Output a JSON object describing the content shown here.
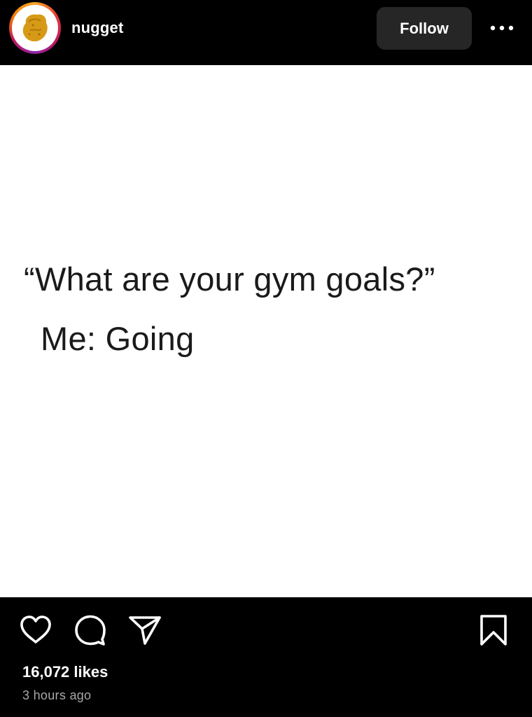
{
  "post": {
    "username": "nugget",
    "follow_label": "Follow",
    "image_text": {
      "line1": "“What are your gym goals?”",
      "line2": "Me: Going"
    },
    "likes_text": "16,072 likes",
    "timestamp": "3 hours ago"
  },
  "icons": {
    "more": "more-horizontal-icon",
    "like": "heart-icon",
    "comment": "comment-bubble-icon",
    "share": "paper-plane-icon",
    "save": "bookmark-icon"
  },
  "colors": {
    "background": "#000000",
    "follow_button_bg": "#262626",
    "image_bg": "#ffffff",
    "meme_text": "#1a1a1a",
    "timestamp_text": "#a8a8a8"
  }
}
